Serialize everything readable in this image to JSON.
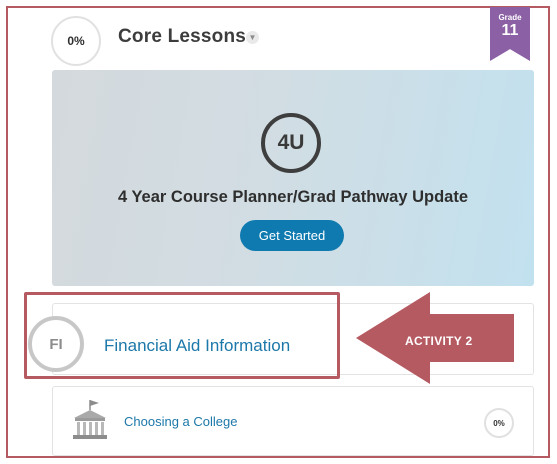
{
  "section": {
    "progress": "0%",
    "title": "Core Lessons",
    "chevron_icon": "chevron-down-icon"
  },
  "grade_ribbon": {
    "label": "Grade",
    "value": "11",
    "color": "#8b60a5"
  },
  "feature_card": {
    "badge": "4U",
    "title": "4 Year Course Planner/Grad Pathway Update",
    "button_label": "Get Started",
    "button_color": "#0f7ab0"
  },
  "activity": {
    "initials": "FI",
    "title": "Financial Aid Information"
  },
  "callout": {
    "label": "ACTIVITY 2",
    "color": "#b65a62"
  },
  "lesson": {
    "icon": "college-building-icon",
    "title": "Choosing a College",
    "progress": "0%"
  }
}
